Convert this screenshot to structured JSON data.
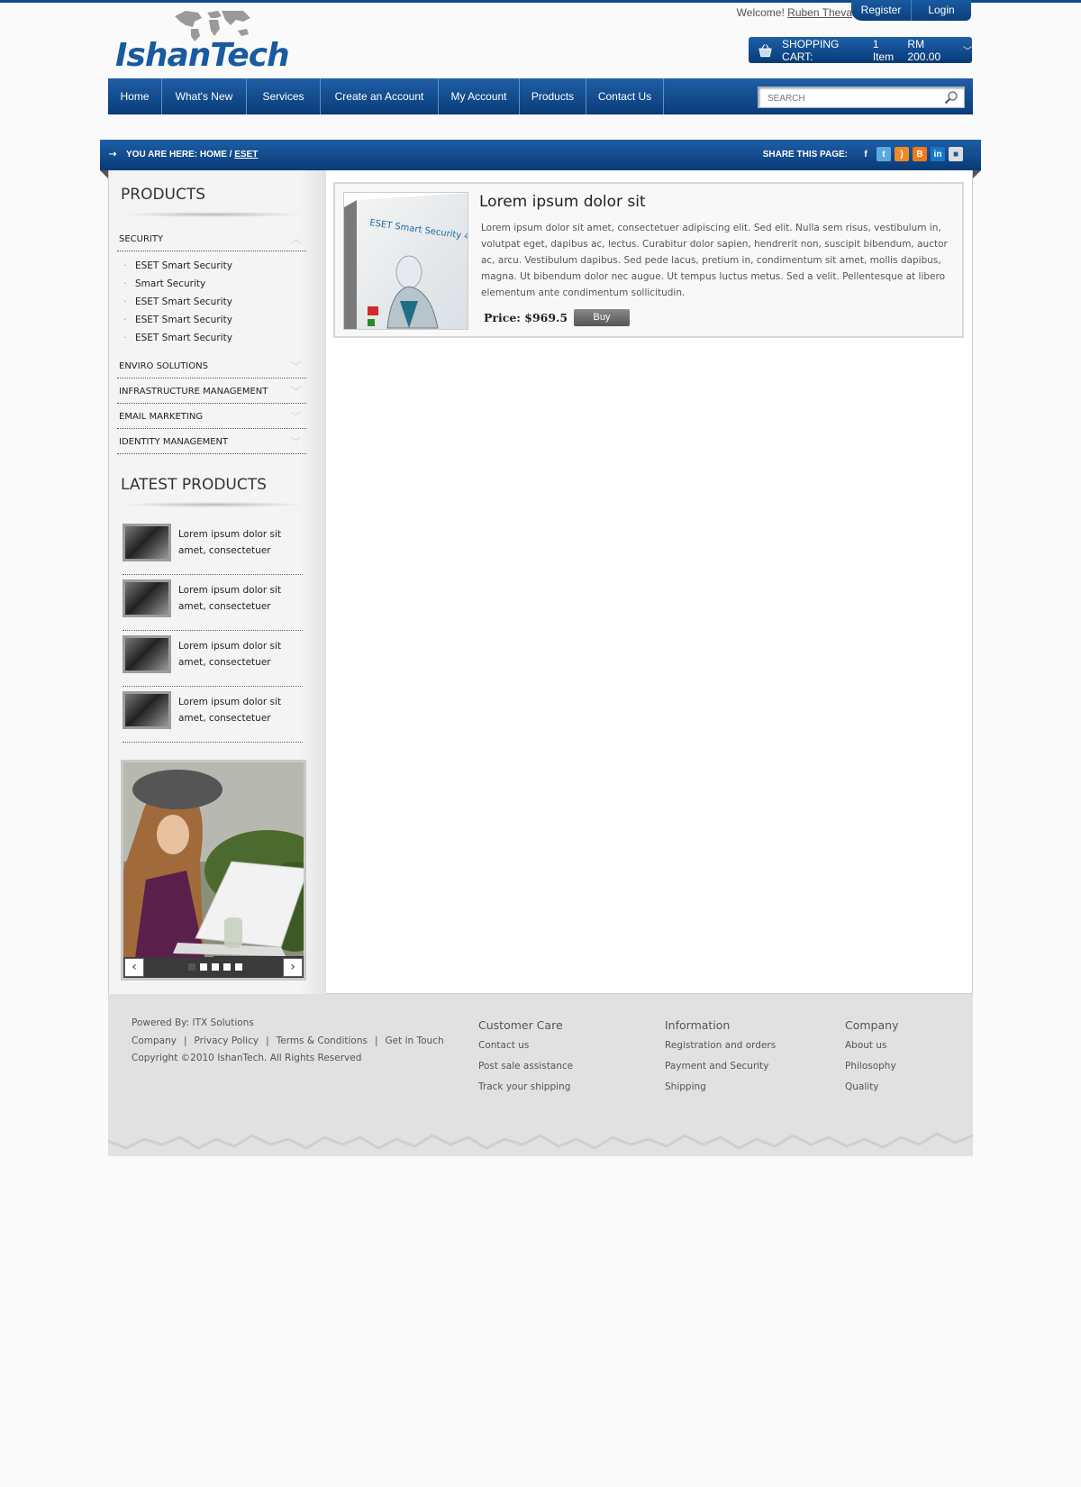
{
  "brand": {
    "logo_text": "IshanTech"
  },
  "header": {
    "welcome_prefix": "Welcome!",
    "user_name": "Ruben Theva",
    "register_label": "Register",
    "login_label": "Login",
    "cart_label": "SHOPPING CART:",
    "cart_items": "1 Item",
    "cart_total": "RM 200.00"
  },
  "nav": {
    "items": [
      "Home",
      "What's New",
      "Services",
      "Create an Account",
      "My Account",
      "Products",
      "Contact Us"
    ],
    "search_placeholder": "SEARCH"
  },
  "breadcrumb": {
    "prefix": "YOU ARE HERE:",
    "home": "HOME",
    "separator": "/",
    "current": "ESET",
    "share_label": "SHARE THIS PAGE:"
  },
  "sidebar": {
    "products_heading": "PRODUCTS",
    "categories": [
      {
        "label": "SECURITY",
        "expanded": true,
        "items": [
          "ESET Smart Security",
          "Smart Security",
          "ESET Smart Security",
          "ESET Smart Security",
          "ESET Smart Security"
        ]
      },
      {
        "label": "ENVIRO SOLUTIONS"
      },
      {
        "label": "INFRASTRUCTURE MANAGEMENT"
      },
      {
        "label": "EMAIL MARKETING"
      },
      {
        "label": "IDENTITY MANAGEMENT"
      }
    ],
    "latest_heading": "LATEST PRODUCTS",
    "latest_items": [
      "Lorem ipsum dolor sit amet, consectetuer",
      "Lorem ipsum dolor sit amet, consectetuer",
      "Lorem ipsum dolor sit amet, consectetuer",
      "Lorem ipsum dolor sit amet, consectetuer"
    ],
    "slider": {
      "prev": "‹",
      "next": "›",
      "slide_count": 5,
      "active_index": 0
    }
  },
  "product": {
    "title": "Lorem ipsum dolor sit",
    "description": "Lorem ipsum dolor sit amet, consectetuer adipiscing elit. Sed elit. Nulla sem risus, vestibulum in, volutpat eget, dapibus ac, lectus. Curabitur dolor sapien, hendrerit non, suscipit bibendum, auctor ac, arcu. Vestibulum dapibus. Sed pede lacus, pretium in, condimentum sit amet, mollis dapibus, magna. Ut bibendum dolor nec augue. Ut tempus luctus metus. Sed a velit. Pellentesque at libero elementum ante condimentum sollicitudin.",
    "price": "Price: $969.5",
    "buy_label": "Buy",
    "box_title": "ESET Smart Security 4"
  },
  "footer": {
    "powered_by": "Powered By: ITX Solutions",
    "links": [
      "Company",
      "Privacy Policy",
      "Terms & Conditions",
      "Get in Touch"
    ],
    "link_separator": "|",
    "copyright": "Copyright ©2010 IshanTech. All Rights Reserved",
    "columns": [
      {
        "heading": "Customer Care",
        "items": [
          "Contact us",
          "Post sale assistance",
          "Track your shipping"
        ]
      },
      {
        "heading": "Information",
        "items": [
          "Registration and orders",
          "Payment and Security",
          "Shipping"
        ]
      },
      {
        "heading": "Company",
        "items": [
          "About us",
          "Philosophy",
          "Quality"
        ]
      }
    ]
  },
  "colors": {
    "brand_blue": "#1a5aa0",
    "nav_dark": "#0a3d7a",
    "footer_gray": "#e1e1e1"
  }
}
